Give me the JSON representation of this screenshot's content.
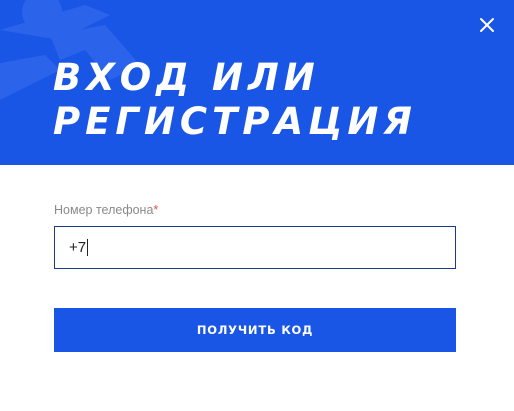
{
  "modal": {
    "title_line1": "ВХОД ИЛИ",
    "title_line2": "РЕГИСТРАЦИЯ",
    "close_icon": "close-icon",
    "header_color": "#1a56e6"
  },
  "form": {
    "phone_label": "Номер телефона",
    "required_mark": "*",
    "phone_value": "+7",
    "submit_label": "ПОЛУЧИТЬ КОД"
  },
  "colors": {
    "accent": "#1a56e6",
    "input_border": "#1d3a8a",
    "label": "#8a8a8a",
    "required": "#d9534f"
  }
}
